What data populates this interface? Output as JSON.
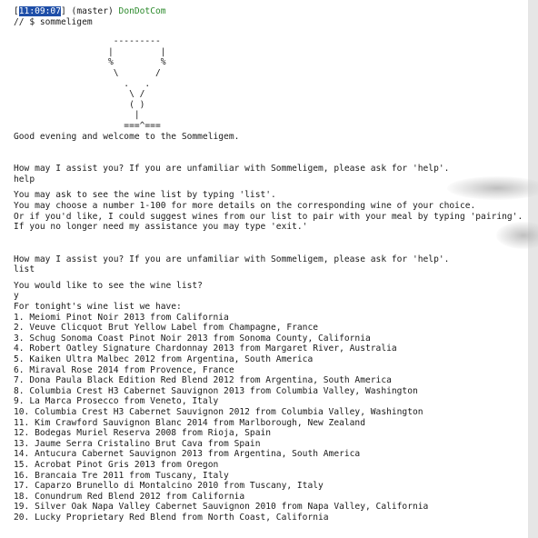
{
  "prompt": {
    "bracket_open": "[",
    "time": "11:09:07",
    "bracket_close": "]",
    "branch": " (master) ",
    "host": "DonDotCom",
    "path_line": "// $ sommeligem"
  },
  "ascii_art": "                   ---------\n                  |         |\n                  %         %\n                   \\       /\n                     .   .\n                      \\ /\n                      ( )\n                       |\n                     ===^===",
  "welcome": "Good evening and welcome to the Sommeligem.",
  "assist_prompt_1": "How may I assist you? If you are unfamiliar with Sommeligem, please ask for 'help'.",
  "user_input_1": "help",
  "help_lines": [
    "You may ask to see the wine list by typing 'list'.",
    "You may choose a number 1-100 for more details on the corresponding wine of your choice.",
    "Or if you'd like, I could suggest wines from our list to pair with your meal by typing 'pairing'.",
    "If you no longer need my assistance you may type 'exit.'"
  ],
  "assist_prompt_2": "How may I assist you? If you are unfamiliar with Sommeligem, please ask for 'help'.",
  "user_input_2": "list",
  "confirm_question": "You would like to see the wine list?",
  "user_input_3": "y",
  "list_header": "For tonight's wine list we have:",
  "wine_list": [
    "1. Meiomi Pinot Noir 2013 from California",
    "2. Veuve Clicquot Brut Yellow Label from Champagne, France",
    "3. Schug Sonoma Coast Pinot Noir 2013 from Sonoma County, California",
    "4. Robert Oatley Signature Chardonnay 2013 from Margaret River, Australia",
    "5. Kaiken Ultra Malbec 2012 from Argentina, South America",
    "6. Miraval Rose 2014 from Provence, France",
    "7. Dona Paula Black Edition Red Blend 2012 from Argentina, South America",
    "8. Columbia Crest H3 Cabernet Sauvignon 2013 from Columbia Valley, Washington",
    "9. La Marca Prosecco from Veneto, Italy",
    "10. Columbia Crest H3 Cabernet Sauvignon 2012 from Columbia Valley, Washington",
    "11. Kim Crawford Sauvignon Blanc 2014 from Marlborough, New Zealand",
    "12. Bodegas Muriel Reserva 2008 from Rioja, Spain",
    "13. Jaume Serra Cristalino Brut Cava from Spain",
    "14. Antucura Cabernet Sauvignon 2013 from Argentina, South America",
    "15. Acrobat Pinot Gris 2013 from Oregon",
    "16. Brancaia Tre 2011 from Tuscany, Italy",
    "17. Caparzo Brunello di Montalcino 2010 from Tuscany, Italy",
    "18. Conundrum Red Blend 2012 from California",
    "19. Silver Oak Napa Valley Cabernet Sauvignon 2010 from Napa Valley, California",
    "20. Lucky Proprietary Red Blend from North Coast, California"
  ]
}
